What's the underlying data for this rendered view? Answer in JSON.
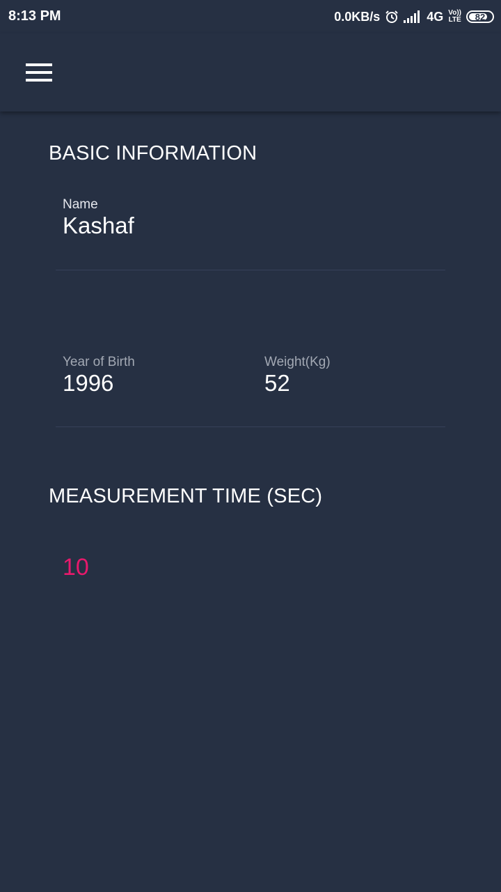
{
  "status_bar": {
    "time": "8:13 PM",
    "network_speed": "0.0KB/s",
    "network_type": "4G",
    "volte_line1": "Vo))",
    "volte_line2": "LTE",
    "battery_percent": "82",
    "battery_level": 0.82,
    "icons": [
      "alarm-icon",
      "signal-icon",
      "volte-icon",
      "battery-icon"
    ]
  },
  "appbar": {
    "menu_icon": "hamburger-menu-icon"
  },
  "basic_info": {
    "title": "BASIC INFORMATION",
    "name_label": "Name",
    "name_value": "Kashaf",
    "birth_label": "Year of Birth",
    "birth_value": "1996",
    "weight_label": "Weight(Kg)",
    "weight_value": "52"
  },
  "measurement": {
    "title": "MEASUREMENT TIME (SEC)",
    "value": "10"
  },
  "colors": {
    "background": "#263043",
    "accent": "#e8196c",
    "divider": "#36415a"
  }
}
